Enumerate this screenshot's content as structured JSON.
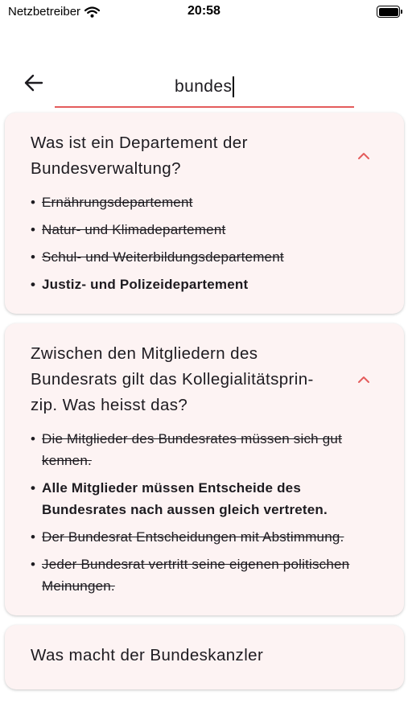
{
  "status": {
    "carrier": "Netzbetreiber",
    "time": "20:58"
  },
  "search": {
    "query": "bundes"
  },
  "colors": {
    "accent": "#e45c5c",
    "card_bg": "#fdf3f3"
  },
  "results": [
    {
      "question": "Was ist ein Departement der Bundesverwaltung?",
      "answers": [
        {
          "text": "Ernährungsdepartement",
          "correct": false
        },
        {
          "text": "Natur- und Klimadepartement",
          "correct": false
        },
        {
          "text": "Schul- und Weiterbildungsdepartement",
          "correct": false
        },
        {
          "text": "Justiz- und Polizeidepartement",
          "correct": true
        }
      ]
    },
    {
      "question": "Zwischen den Mitgliedern des Bundesrats gilt das Kollegialitätsprin- zip. Was heisst das?",
      "answers": [
        {
          "text": "Die Mitglieder des Bundesrates müssen sich gut kennen.",
          "correct": false
        },
        {
          "text": "Alle Mitglieder müssen Entscheide des Bundesrates nach aussen gleich vertreten.",
          "correct": true
        },
        {
          "text": "Der Bundesrat Entscheidungen mit Abstimmung.",
          "correct": false
        },
        {
          "text": "Jeder Bundesrat vertritt seine eigenen politischen Meinungen.",
          "correct": false
        }
      ]
    },
    {
      "question": "Was macht der Bundeskanzler"
    }
  ]
}
